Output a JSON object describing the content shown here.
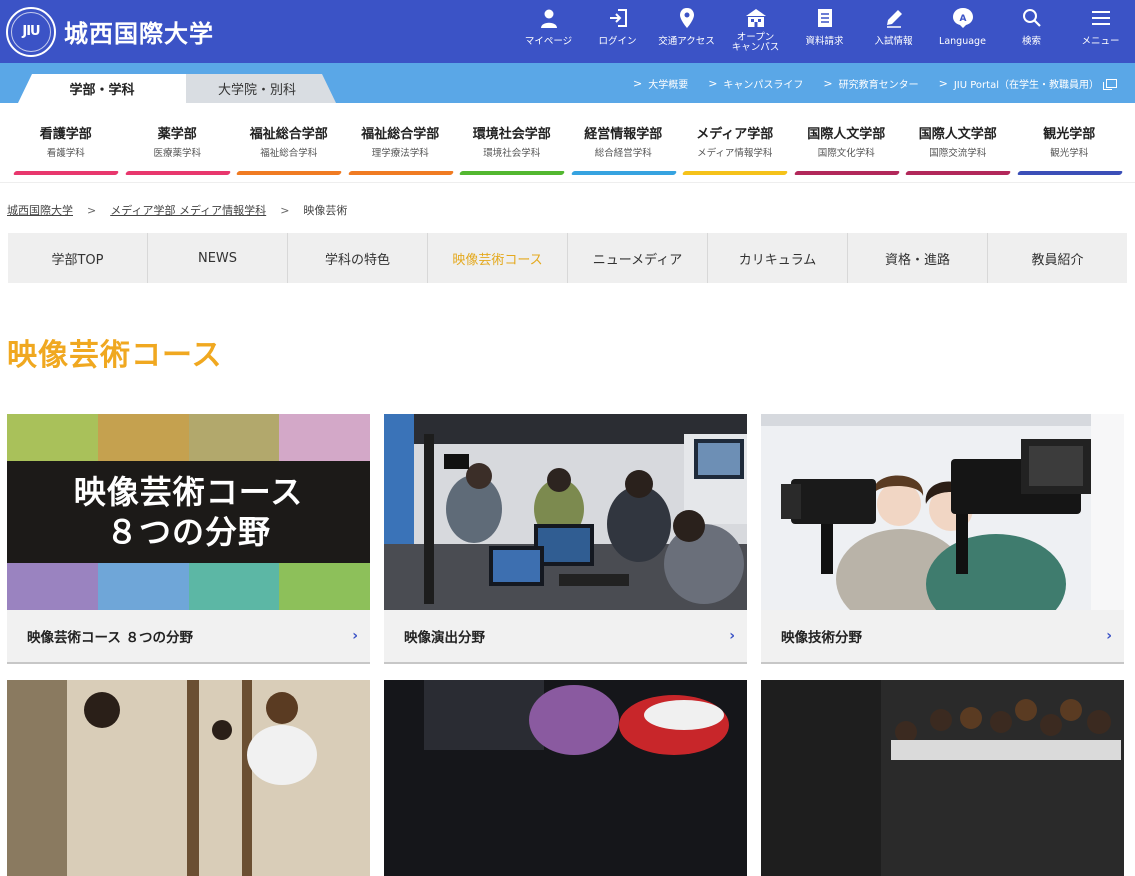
{
  "header": {
    "logo_seal": "JIU",
    "logo_name": "城西国際大学",
    "nav": [
      {
        "label": "マイページ",
        "icon": "person-icon"
      },
      {
        "label": "ログイン",
        "icon": "login-icon"
      },
      {
        "label": "交通アクセス",
        "icon": "map-pin-icon"
      },
      {
        "label": "オープン\nキャンパス",
        "icon": "campus-icon"
      },
      {
        "label": "資料請求",
        "icon": "document-icon"
      },
      {
        "label": "入試情報",
        "icon": "pencil-icon"
      },
      {
        "label": "Language",
        "icon": "language-icon"
      },
      {
        "label": "検索",
        "icon": "search-icon"
      },
      {
        "label": "メニュー",
        "icon": "menu-icon"
      }
    ]
  },
  "tabs": {
    "active": "学部・学科",
    "inactive": "大学院・別科"
  },
  "sublinks": [
    {
      "label": "大学概要"
    },
    {
      "label": "キャンパスライフ"
    },
    {
      "label": "研究教育センター"
    },
    {
      "label": "JIU Portal（在学生・教職員用）"
    }
  ],
  "faculties": [
    {
      "name": "看護学部",
      "sub": "看護学科",
      "color": "#e8376d"
    },
    {
      "name": "薬学部",
      "sub": "医療薬学科",
      "color": "#e8376d"
    },
    {
      "name": "福祉総合学部",
      "sub": "福祉総合学科",
      "color": "#f07b22"
    },
    {
      "name": "福祉総合学部",
      "sub": "理学療法学科",
      "color": "#f07b22"
    },
    {
      "name": "環境社会学部",
      "sub": "環境社会学科",
      "color": "#53b730"
    },
    {
      "name": "経営情報学部",
      "sub": "総合経営学科",
      "color": "#36a3e0"
    },
    {
      "name": "メディア学部",
      "sub": "メディア情報学科",
      "color": "#f5c21a"
    },
    {
      "name": "国際人文学部",
      "sub": "国際文化学科",
      "color": "#b2285a"
    },
    {
      "name": "国際人文学部",
      "sub": "国際交流学科",
      "color": "#b2285a"
    },
    {
      "name": "観光学部",
      "sub": "観光学科",
      "color": "#3b4fb8"
    }
  ],
  "breadcrumb": {
    "home": "城西国際大学",
    "sep": ">",
    "parent": "メディア学部 メディア情報学科",
    "current": "映像芸術"
  },
  "subnav": [
    {
      "label": "学部TOP"
    },
    {
      "label": "NEWS"
    },
    {
      "label": "学科の特色"
    },
    {
      "label": "映像芸術コース"
    },
    {
      "label": "ニューメディア"
    },
    {
      "label": "カリキュラム"
    },
    {
      "label": "資格・進路"
    },
    {
      "label": "教員紹介"
    }
  ],
  "page_title": "映像芸術コース",
  "cards": [
    {
      "caption": "映像芸術コース ８つの分野",
      "banner_line1": "映像芸術コース",
      "banner_line2": "８つの分野"
    },
    {
      "caption": "映像演出分野"
    },
    {
      "caption": "映像技術分野"
    }
  ],
  "arrow": "›",
  "colors": {
    "brand_blue": "#3b53c6",
    "tab_bar_blue": "#5aa7e7",
    "accent_orange": "#f0a820"
  }
}
